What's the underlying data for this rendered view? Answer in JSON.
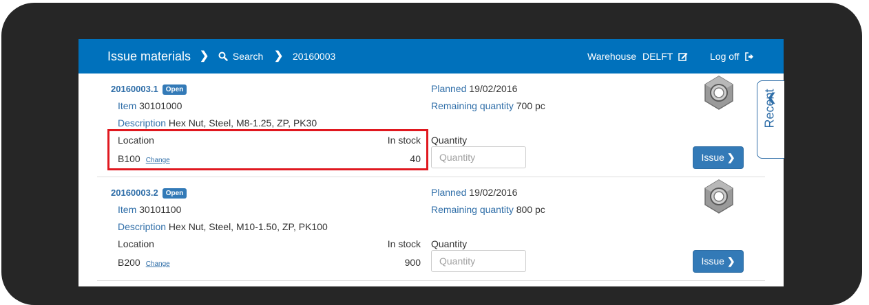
{
  "header": {
    "title": "Issue materials",
    "search_label": "Search",
    "order_number": "20160003",
    "warehouse_label": "Warehouse",
    "warehouse_value": "DELFT",
    "logoff_label": "Log off"
  },
  "side_tab": {
    "recent_label": "Recent"
  },
  "labels": {
    "item": "Item",
    "description": "Description",
    "location": "Location",
    "in_stock": "In stock",
    "planned": "Planned",
    "remaining_quantity": "Remaining quantity",
    "quantity": "Quantity",
    "change": "Change",
    "issue": "Issue",
    "quantity_placeholder": "Quantity"
  },
  "lines": [
    {
      "line_number": "20160003.1",
      "status": "Open",
      "item": "30101000",
      "description": "Hex Nut, Steel, M8-1.25, ZP, PK30",
      "location": "B100",
      "in_stock": "40",
      "planned": "19/02/2016",
      "remaining_quantity": "700 pc"
    },
    {
      "line_number": "20160003.2",
      "status": "Open",
      "item": "30101100",
      "description": "Hex Nut, Steel, M10-1.50, ZP, PK100",
      "location": "B200",
      "in_stock": "900",
      "planned": "19/02/2016",
      "remaining_quantity": "800 pc"
    }
  ],
  "colors": {
    "header_bg": "#0071bc",
    "accent": "#337ab7",
    "label": "#2f6ea8",
    "highlight": "#e0181f",
    "device": "#262626"
  }
}
